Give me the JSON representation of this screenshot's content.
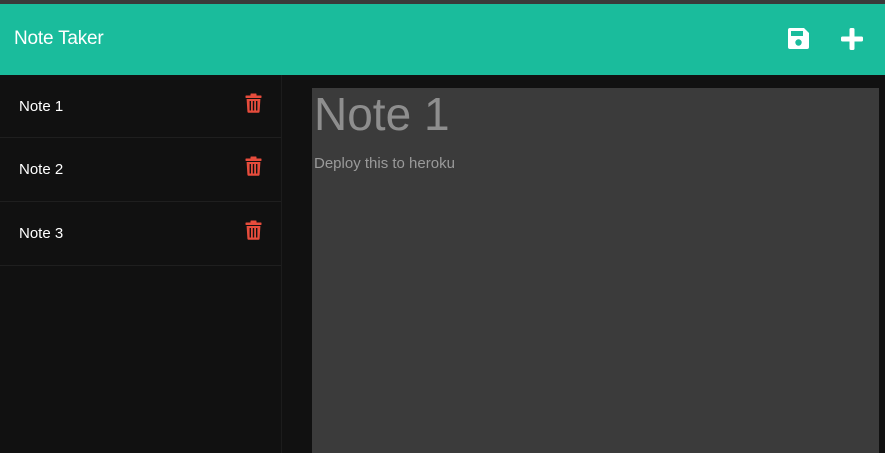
{
  "app": {
    "title": "Note Taker",
    "accent_color": "#1abc9c",
    "danger_color": "#e74c3c"
  },
  "toolbar": {
    "save_icon": "floppy-disk-icon",
    "new_icon": "plus-icon"
  },
  "notes": [
    {
      "title": "Note 1",
      "icon": "trash-icon"
    },
    {
      "title": "Note 2",
      "icon": "trash-icon"
    },
    {
      "title": "Note 3",
      "icon": "trash-icon"
    }
  ],
  "editor": {
    "title": "Note 1",
    "body": "Deploy this to heroku"
  }
}
